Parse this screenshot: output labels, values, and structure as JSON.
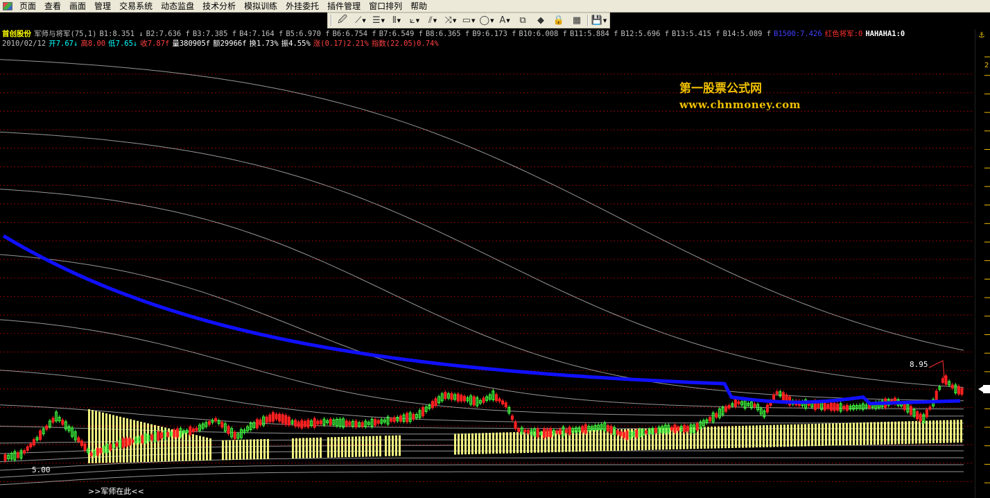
{
  "menu": [
    "页面",
    "查看",
    "画面",
    "管理",
    "交易系统",
    "动态监盘",
    "技术分析",
    "模拟训练",
    "外挂委托",
    "插件管理",
    "窗口排列",
    "帮助"
  ],
  "toolbar": {
    "buttons": [
      {
        "name": "draw-tool-icon",
        "glyph": "🖉",
        "dropdown": false
      },
      {
        "name": "line-tool-icon",
        "glyph": "⟋",
        "dropdown": true
      },
      {
        "name": "channel-tool-icon",
        "glyph": "☰",
        "dropdown": true
      },
      {
        "name": "cycle-tool-icon",
        "glyph": "⦀",
        "dropdown": true
      },
      {
        "name": "gann-tool-icon",
        "glyph": "⟀",
        "dropdown": true
      },
      {
        "name": "parallel-tool-icon",
        "glyph": "⫽",
        "dropdown": true
      },
      {
        "name": "fibonacci-tool-icon",
        "glyph": "⤨",
        "dropdown": true
      },
      {
        "name": "rectangle-tool-icon",
        "glyph": "▭",
        "dropdown": true
      },
      {
        "name": "ellipse-tool-icon",
        "glyph": "◯",
        "dropdown": true
      },
      {
        "name": "text-tool-icon",
        "glyph": "A",
        "dropdown": true
      },
      {
        "name": "copy-icon",
        "glyph": "⧉",
        "dropdown": false
      },
      {
        "name": "diamond-icon",
        "glyph": "◆",
        "dropdown": false
      },
      {
        "name": "lock-icon",
        "glyph": "🔒",
        "dropdown": false
      },
      {
        "name": "grid-color-icon",
        "glyph": "▦",
        "dropdown": false
      },
      {
        "name": "save-icon",
        "glyph": "💾",
        "dropdown": true
      }
    ]
  },
  "info": {
    "stock_name": "首创股份",
    "indicator": "军师与将军(75,1)",
    "b_values": [
      {
        "label": "B1:8.351",
        "arrow": "↓"
      },
      {
        "label": "B2:7.636",
        "arrow": "f"
      },
      {
        "label": "B3:7.385",
        "arrow": "f"
      },
      {
        "label": "B4:7.164",
        "arrow": "f"
      },
      {
        "label": "B5:6.970",
        "arrow": "f"
      },
      {
        "label": "B6:6.754",
        "arrow": "f"
      },
      {
        "label": "B7:6.549",
        "arrow": "f"
      },
      {
        "label": "B8:6.365",
        "arrow": "f"
      },
      {
        "label": "B9:6.173",
        "arrow": "f"
      },
      {
        "label": "B10:6.008",
        "arrow": "f"
      },
      {
        "label": "B11:5.884",
        "arrow": "f"
      },
      {
        "label": "B12:5.696",
        "arrow": "f"
      },
      {
        "label": "B13:5.415",
        "arrow": "f"
      },
      {
        "label": "B14:5.089",
        "arrow": "f"
      }
    ],
    "b1500": "B1500:7.426",
    "red_general": "红色将军:0",
    "hahaha": "HAHAHA1:0",
    "date": "2010/02/12",
    "open": "开7.67↓",
    "high": "高8.00",
    "low": "低7.65↓",
    "close": "收7.87f",
    "volume": "量380905f",
    "amount": "额29966f",
    "turnover": "换1.73%",
    "amplitude": "振4.55%",
    "change": "涨(0.17)2.21%",
    "index_change": "指数(22.05)0.74%"
  },
  "watermark": {
    "line1": "第一股票公式网",
    "line2": "www.chnmoney.com"
  },
  "labels": {
    "high": "8.95",
    "low": "5.00",
    "bottom": ">>军师在此<<"
  },
  "scale": {
    "top": "⚓",
    "tick": "2"
  },
  "colors": {
    "bg": "#000000",
    "grid": "#8b0000",
    "ma_line": "#1010ff",
    "curves": "#c8c8c8",
    "up_candle": "#ff2020",
    "down_candle": "#40ff40",
    "volume_bars": "#f0f080",
    "info_cyan": "#00ffff",
    "info_yellow": "#ffff00",
    "info_red": "#ff4040",
    "info_blue": "#4040ff"
  }
}
